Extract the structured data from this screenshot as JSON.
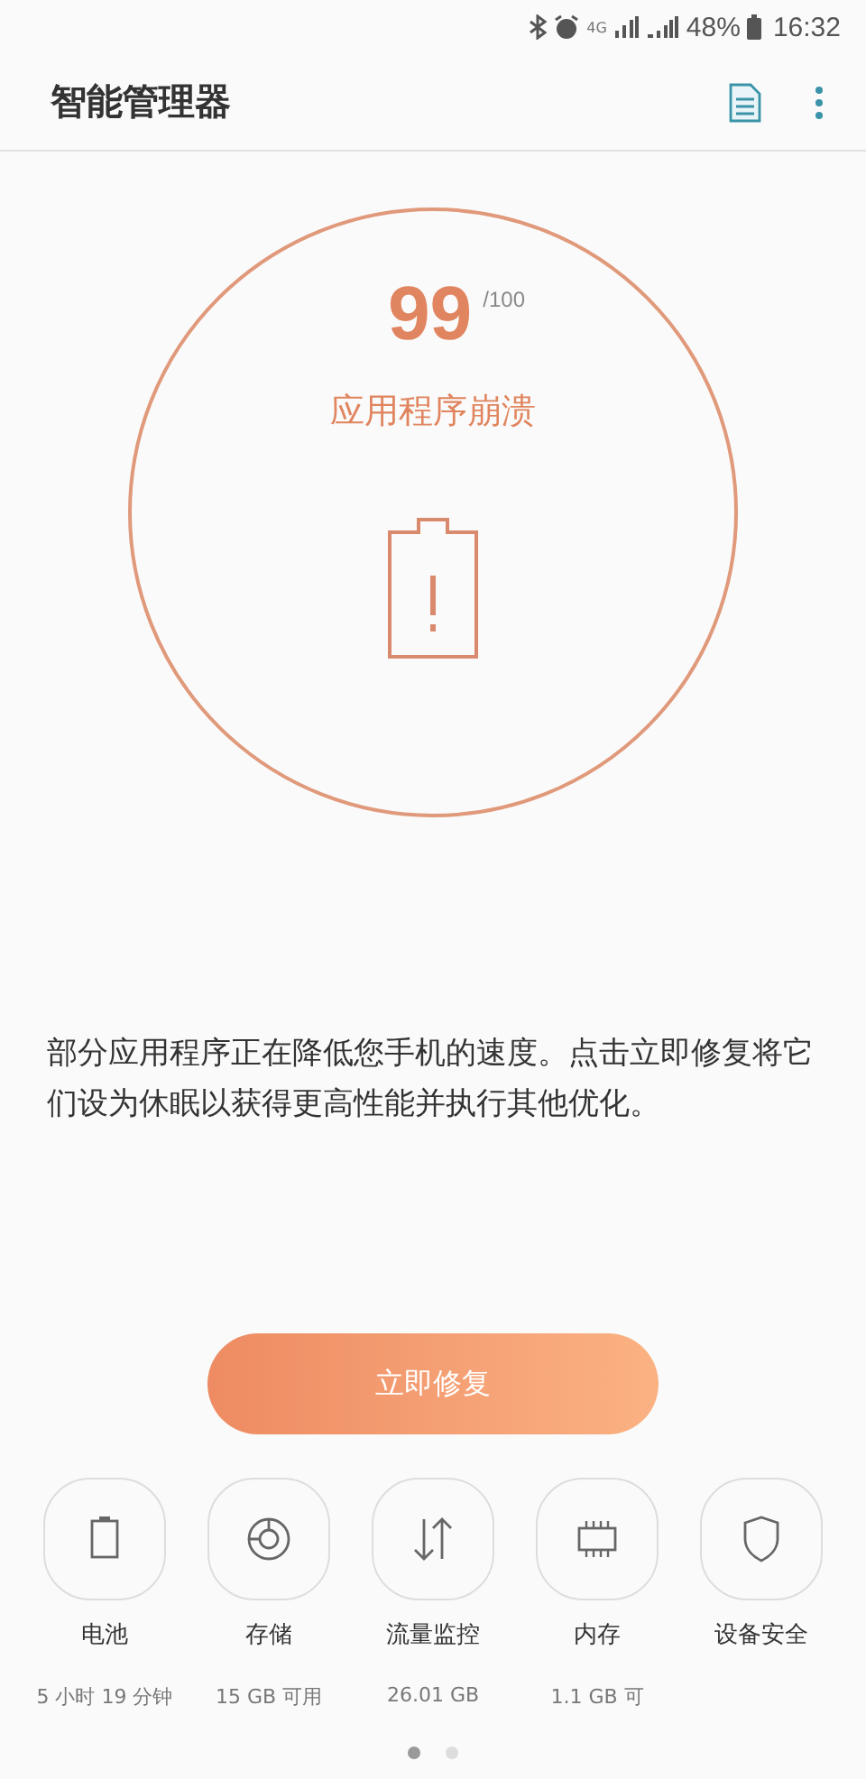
{
  "status_bar": {
    "network": "4G",
    "battery": "48%",
    "time": "16:32"
  },
  "header": {
    "title": "智能管理器"
  },
  "score": {
    "value": "99",
    "max": "/100",
    "status": "应用程序崩溃"
  },
  "description": "部分应用程序正在降低您手机的速度。点击立即修复将它们设为休眠以获得更高性能并执行其他优化。",
  "fix_button": "立即修复",
  "tools": [
    {
      "kind": "battery",
      "label": "电池",
      "detail": "5 小时 19 分钟"
    },
    {
      "kind": "storage",
      "label": "存储",
      "detail": "15 GB 可用"
    },
    {
      "kind": "data",
      "label": "流量监控",
      "detail": "26.01 GB"
    },
    {
      "kind": "memory",
      "label": "内存",
      "detail": "1.1 GB 可"
    },
    {
      "kind": "security",
      "label": "设备安全"
    }
  ],
  "pages": [
    {
      "selected": true
    },
    {
      "selected": false
    }
  ]
}
